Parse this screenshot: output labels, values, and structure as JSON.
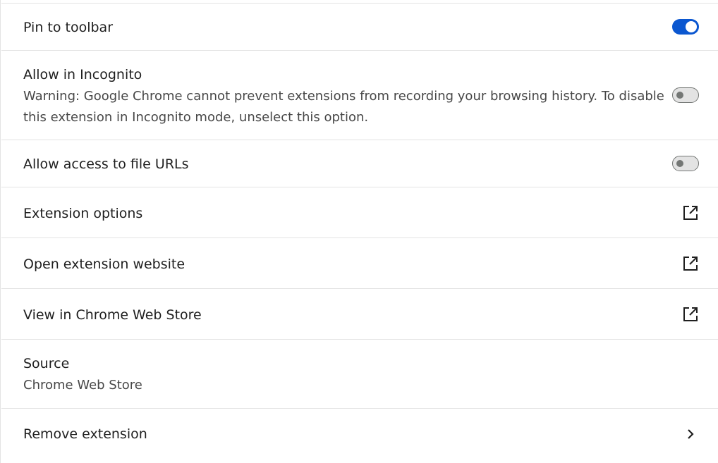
{
  "settings": {
    "pin_to_toolbar": {
      "label": "Pin to toolbar",
      "enabled": true
    },
    "allow_incognito": {
      "label": "Allow in Incognito",
      "warning_line1": "Warning: Google Chrome cannot prevent extensions from recording your browsing history. To disable",
      "warning_line2": "this extension in Incognito mode, unselect this option.",
      "enabled": false
    },
    "allow_file_urls": {
      "label": "Allow access to file URLs",
      "enabled": false
    },
    "extension_options": {
      "label": "Extension options",
      "icon": "open-in-new-icon"
    },
    "open_website": {
      "label": "Open extension website",
      "icon": "open-in-new-icon"
    },
    "view_store": {
      "label": "View in Chrome Web Store",
      "icon": "open-in-new-icon"
    },
    "source": {
      "label": "Source",
      "value": "Chrome Web Store"
    },
    "remove_extension": {
      "label": "Remove extension",
      "icon": "chevron-right-icon"
    }
  },
  "colors": {
    "accent": "#0b57d0",
    "divider": "#e3e3e3",
    "text": "#1f1f1f",
    "secondary_text": "#474747"
  }
}
